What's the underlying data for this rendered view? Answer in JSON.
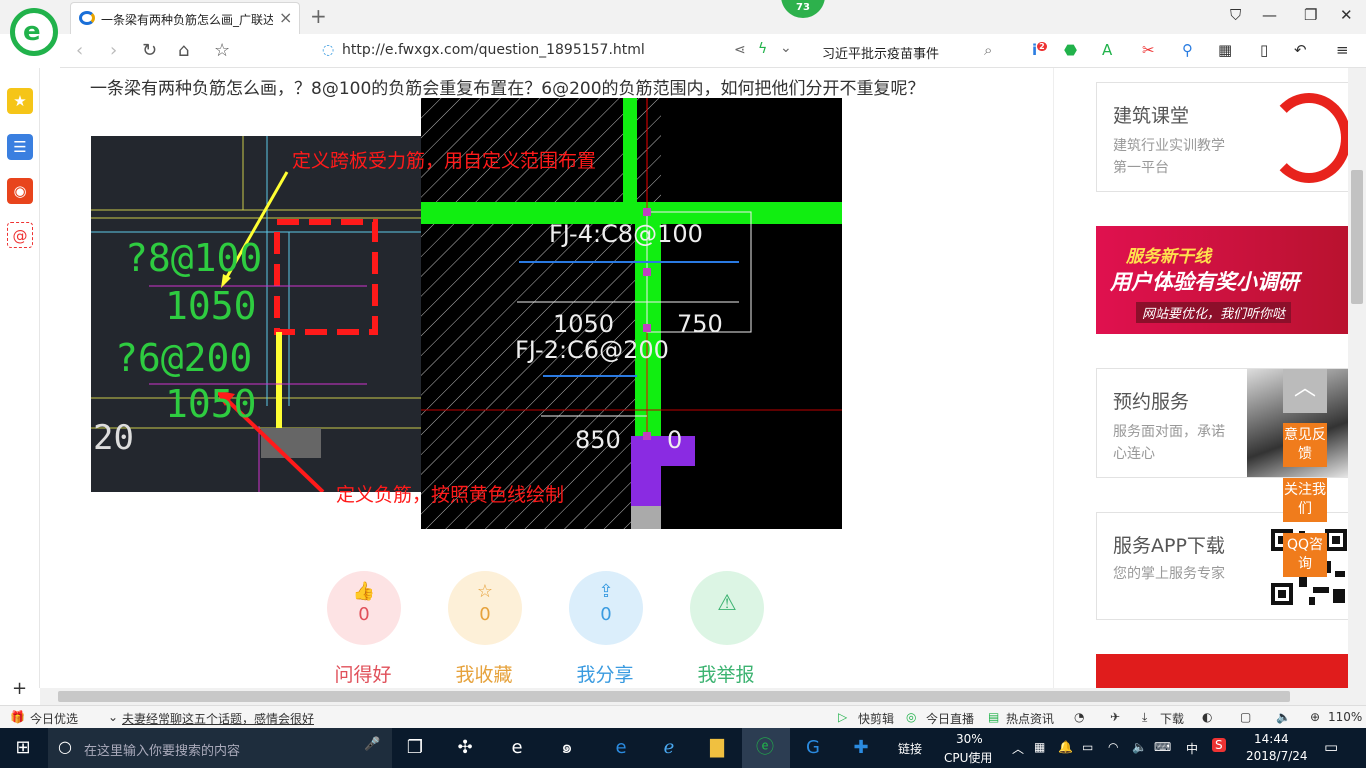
{
  "browser": {
    "tab_title": "一条梁有两种负筋怎么画_广联达",
    "tab_close": "×",
    "new_tab": "+",
    "notification_count": "73",
    "url": "http://e.fwxgx.com/question_1895157.html",
    "search_text": "习近平批示疫苗事件",
    "plugin_badge": "2"
  },
  "page": {
    "question_title": "一条梁有两种负筋怎么画，？8@100的负筋会重复布置在？6@200的负筋范围内，如何把他们分开不重复呢？",
    "cad_left": {
      "texts": [
        "?8@100",
        "1050",
        "?6@200",
        "1050",
        "20"
      ],
      "annotation_top": "定义跨板受力筋，用自定义范围布置",
      "annotation_bottom": "定义负筋，按照黄色线绘制"
    },
    "cad_right": {
      "texts": [
        "FJ-4:C8@100",
        "1050",
        "750",
        "FJ-2:C6@200",
        "850",
        "0"
      ]
    },
    "actions": [
      {
        "label": "问得好",
        "count": "0",
        "color": "#e0505a",
        "bg": "#fde3e4"
      },
      {
        "label": "我收藏",
        "count": "0",
        "color": "#e6a23c",
        "bg": "#fdf0d8"
      },
      {
        "label": "我分享",
        "count": "0",
        "color": "#3a9be0",
        "bg": "#dbeefb"
      },
      {
        "label": "我举报",
        "count": "",
        "color": "#3cb371",
        "bg": "#dcf5e4"
      }
    ]
  },
  "sidebar_right": {
    "cards": [
      {
        "title": "建筑课堂",
        "subtitle": "建筑行业实训教学第一平台"
      },
      {
        "banner_title": "服务新干线",
        "banner_main": "用户体验有奖小调研",
        "banner_sub": "网站要优化，我们听你哒"
      },
      {
        "title": "预约服务",
        "subtitle": "服务面对面，承诺心连心"
      },
      {
        "title": "服务APP下载",
        "subtitle": "您的掌上服务专家"
      }
    ],
    "float_buttons": [
      "意见反馈",
      "关注我们",
      "QQ咨询"
    ]
  },
  "statusbar": {
    "today_pick": "今日优选",
    "headline": "夫妻经常聊这五个话题，感情会很好",
    "quick_clip": "快剪辑",
    "live": "今日直播",
    "hot_news": "热点资讯",
    "download": "下载",
    "zoom": "110%"
  },
  "taskbar": {
    "search_placeholder": "在这里输入你要搜索的内容",
    "links": "链接",
    "cpu_percent": "30%",
    "cpu_label": "CPU使用",
    "ime": "中",
    "time": "14:44",
    "date": "2018/7/24"
  }
}
